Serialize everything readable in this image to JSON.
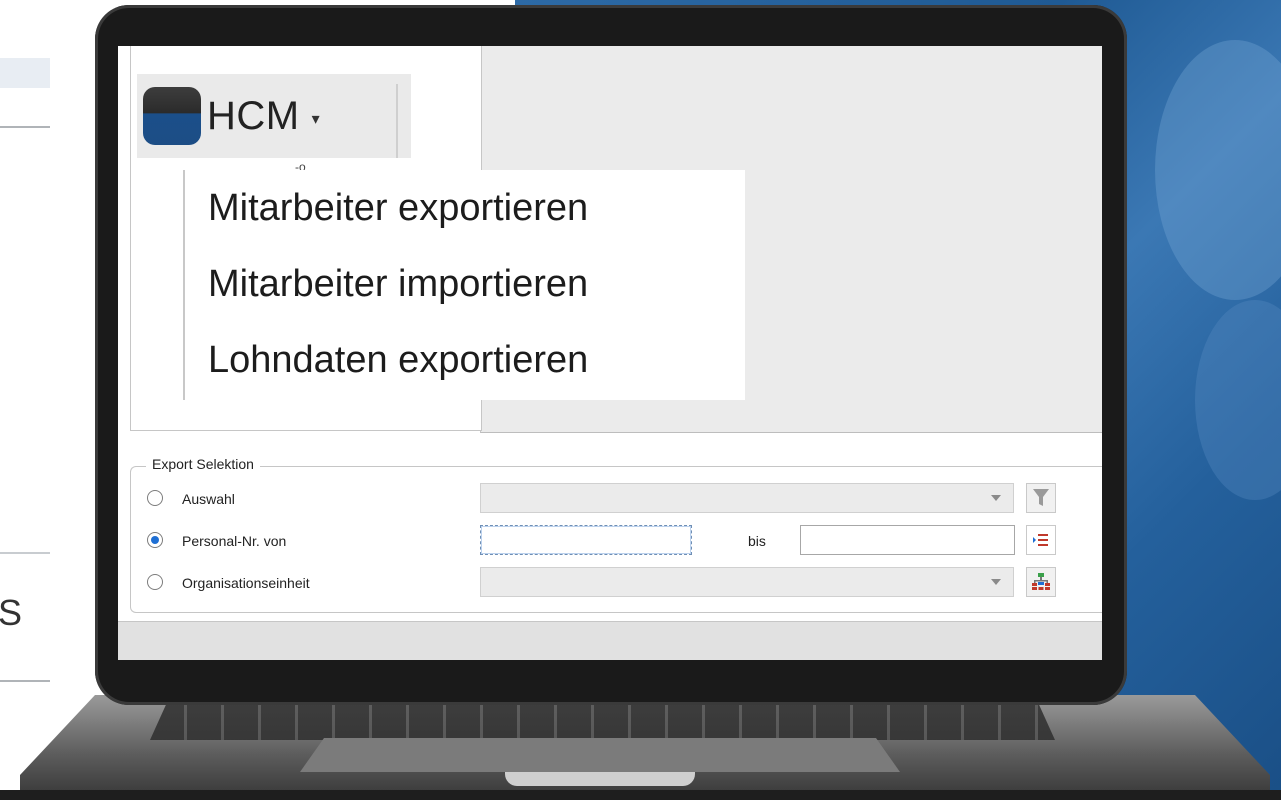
{
  "background": {
    "left_fragment_text": "S",
    "right_color": "#2a66a3"
  },
  "app": {
    "menu_button": {
      "label": "HCM",
      "caret": "▾",
      "logo_colors": [
        "#2b2b2b",
        "#1c4d85"
      ]
    },
    "dropdown": {
      "tick": "-o",
      "items": [
        {
          "label": "Mitarbeiter exportieren"
        },
        {
          "label": "Mitarbeiter importieren"
        },
        {
          "label": "Lohndaten exportieren"
        }
      ]
    },
    "export_selection": {
      "title": "Export Selektion",
      "rows": {
        "selection": {
          "label": "Auswahl",
          "checked": false,
          "value": ""
        },
        "personnel": {
          "label": "Personal-Nr. von",
          "checked": true,
          "from_value": "",
          "to_label": "bis",
          "to_value": ""
        },
        "org_unit": {
          "label": "Organisationseinheit",
          "checked": false,
          "value": ""
        }
      },
      "icons": [
        "filter-icon",
        "list-icon",
        "org-chart-icon"
      ]
    },
    "accent_color": "#1e6fd4"
  }
}
